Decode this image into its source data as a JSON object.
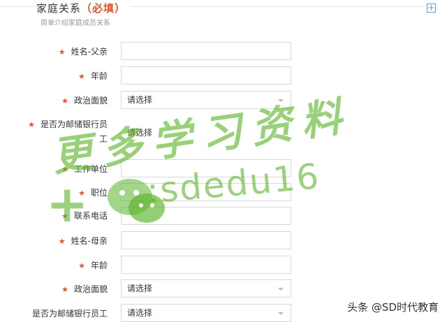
{
  "section": {
    "title": "家庭关系",
    "required_tag": "（必填）",
    "subtitle": "简单介绍家庭成员关系",
    "add_icon": "plus-square-icon"
  },
  "fields": [
    {
      "label": "姓名-父亲",
      "required": true,
      "type": "input",
      "value": ""
    },
    {
      "label": "年龄",
      "required": true,
      "type": "input",
      "value": ""
    },
    {
      "label": "政治面貌",
      "required": true,
      "type": "select",
      "value": "请选择"
    },
    {
      "label_line1": "是否为邮储银行员",
      "label_line2": "工",
      "required": true,
      "type": "select",
      "value": "请选择"
    },
    {
      "label": "工作单位",
      "required": true,
      "type": "input",
      "value": ""
    },
    {
      "label": "职位",
      "required": true,
      "type": "input",
      "value": ""
    },
    {
      "label": "联系电话",
      "required": true,
      "type": "input",
      "value": ""
    },
    {
      "label": "姓名-母亲",
      "required": true,
      "type": "input",
      "value": ""
    },
    {
      "label": "年龄",
      "required": true,
      "type": "input",
      "value": ""
    },
    {
      "label": "政治面貌",
      "required": true,
      "type": "select",
      "value": "请选择"
    },
    {
      "label": "是否为邮储银行员工",
      "required": false,
      "type": "select",
      "value": "请选择"
    }
  ],
  "watermark": {
    "chinese": "更多学习资料",
    "wechat_id": ":sdedu16",
    "footer": "头条 @SD时代教育"
  },
  "colors": {
    "required_star": "#e0532f",
    "add_button": "#5b9bd5",
    "watermark": "#5ab428"
  }
}
